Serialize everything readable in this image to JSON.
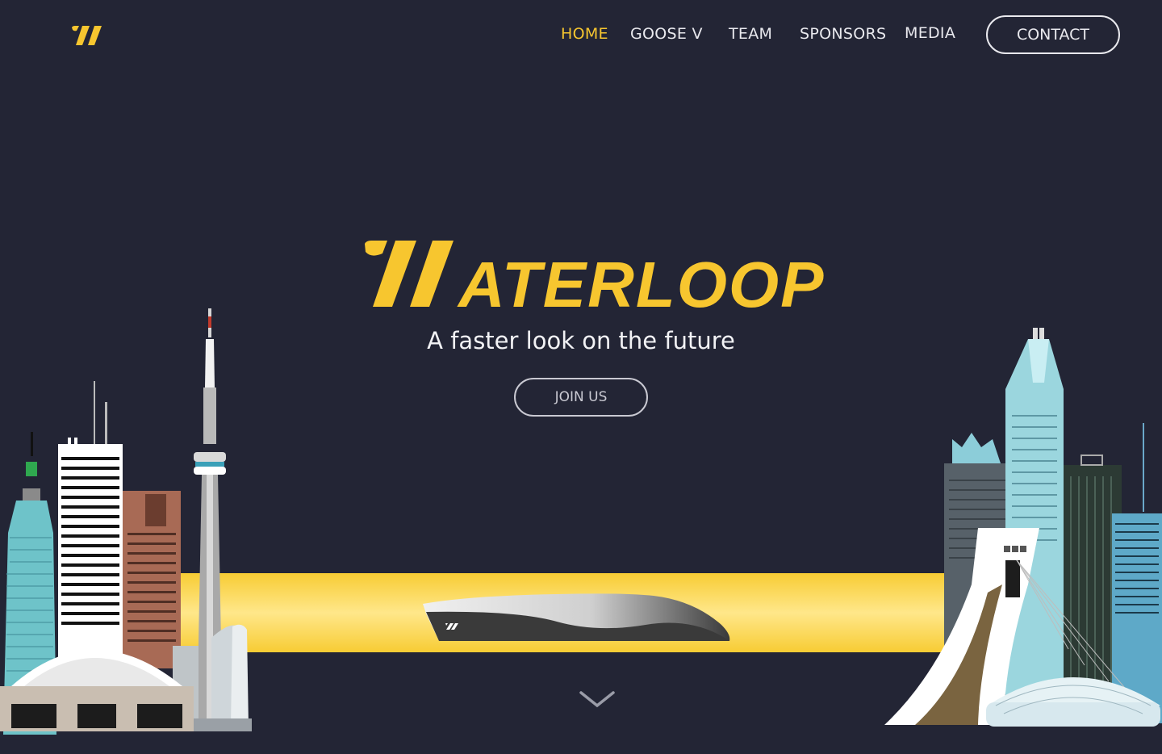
{
  "brand": {
    "accent": "#f7c62f",
    "background": "#232535",
    "hero_title": "ATERLOOP"
  },
  "nav": {
    "items": [
      {
        "label": "HOME",
        "active": true
      },
      {
        "label": "GOOSE V",
        "active": false
      },
      {
        "label": "TEAM",
        "active": false
      },
      {
        "label": "SPONSORS",
        "active": false
      },
      {
        "label": "MEDIA",
        "active": false
      }
    ],
    "contact_label": "CONTACT"
  },
  "hero": {
    "tagline": "A faster look on the future",
    "cta_label": "JOIN US",
    "pod_icon": "waterloop-logo-mark",
    "scroll_icon": "chevron-down-icon"
  }
}
